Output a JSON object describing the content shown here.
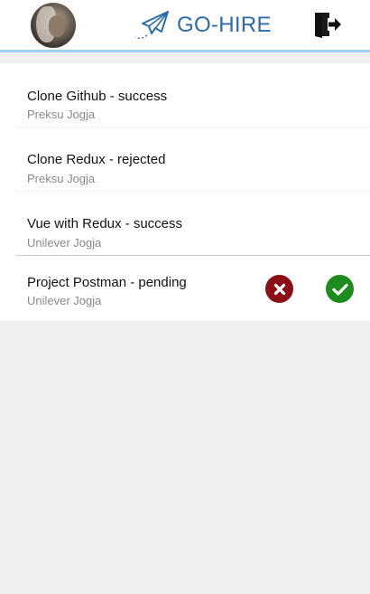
{
  "header": {
    "brand": "GO-HIRE",
    "brand_color": "#2f6aa6",
    "icons": {
      "avatar": "user-avatar",
      "logo": "paper-plane-icon",
      "logout": "logout-door-icon"
    }
  },
  "items": [
    {
      "title": "Clone Github - success",
      "company": "Preksu Jogja"
    },
    {
      "title": "Clone Redux - rejected",
      "company": "Preksu Jogja"
    },
    {
      "title": "Vue with Redux - success",
      "company": "Unilever Jogja"
    },
    {
      "title": "Project Postman - pending",
      "company": "Unilever Jogja"
    }
  ],
  "actions": {
    "reject_icon": "times-circle-icon",
    "accept_icon": "check-circle-icon",
    "reject_color": "#8b0f17",
    "accept_color": "#1e8b1e"
  }
}
